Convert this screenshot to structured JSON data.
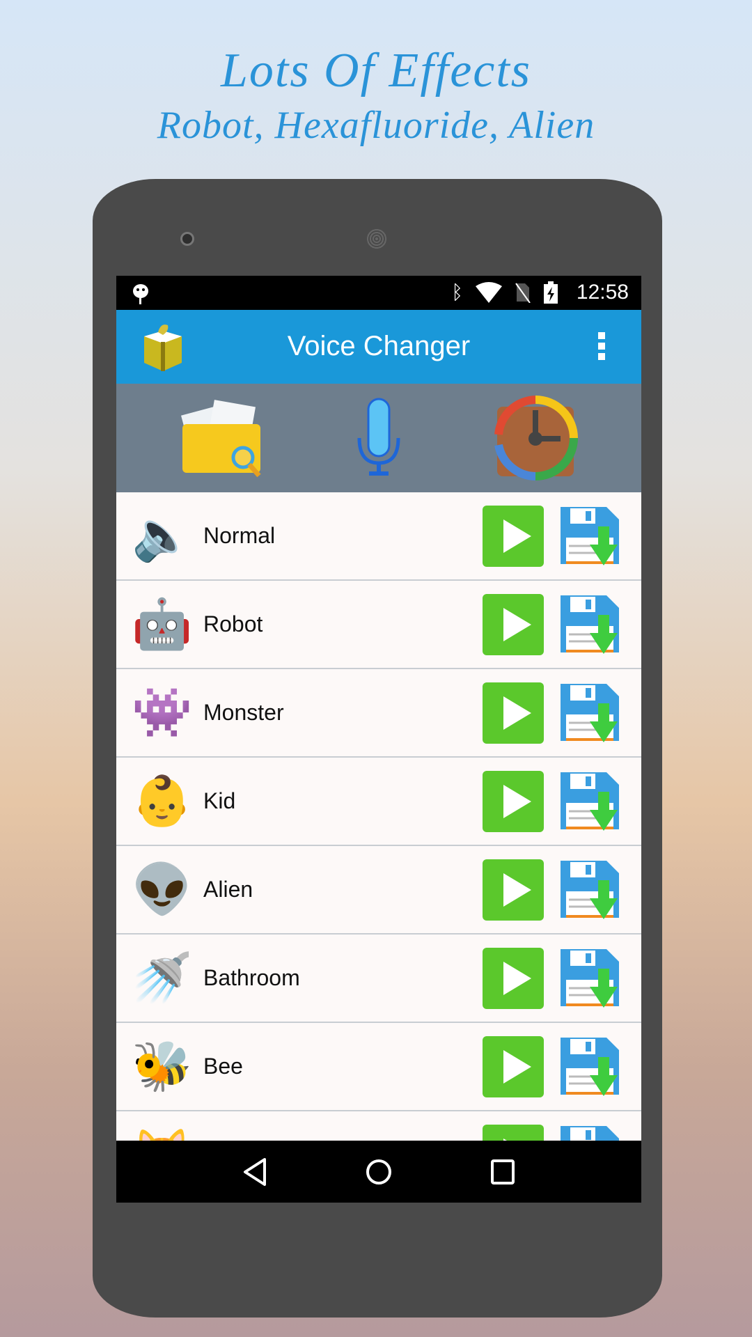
{
  "promo": {
    "line1": "Lots Of Effects",
    "line2": "Robot, Hexafluoride, Alien"
  },
  "status": {
    "time": "12:58",
    "icons": [
      "android-icon",
      "bluetooth-icon",
      "wifi-icon",
      "no-sim-icon",
      "battery-charging-icon"
    ]
  },
  "appbar": {
    "title": "Voice Changer",
    "icons": [
      "gift-icon",
      "overflow-menu-icon"
    ]
  },
  "toolbar": {
    "icons": [
      "folder-search-icon",
      "microphone-icon",
      "music-history-icon"
    ]
  },
  "effects": [
    {
      "label": "Normal",
      "icon": "speaker-icon"
    },
    {
      "label": "Robot",
      "icon": "robot-icon"
    },
    {
      "label": "Monster",
      "icon": "monster-icon"
    },
    {
      "label": "Kid",
      "icon": "baby-icon"
    },
    {
      "label": "Alien",
      "icon": "alien-icon"
    },
    {
      "label": "Bathroom",
      "icon": "shower-icon"
    },
    {
      "label": "Bee",
      "icon": "bee-icon"
    },
    {
      "label": "",
      "icon": "partial-icon"
    }
  ],
  "colors": {
    "appbar": "#1a98d9",
    "toolbar": "#6e7e8d",
    "play": "#5bc82c",
    "save": "#3a9ee0"
  }
}
